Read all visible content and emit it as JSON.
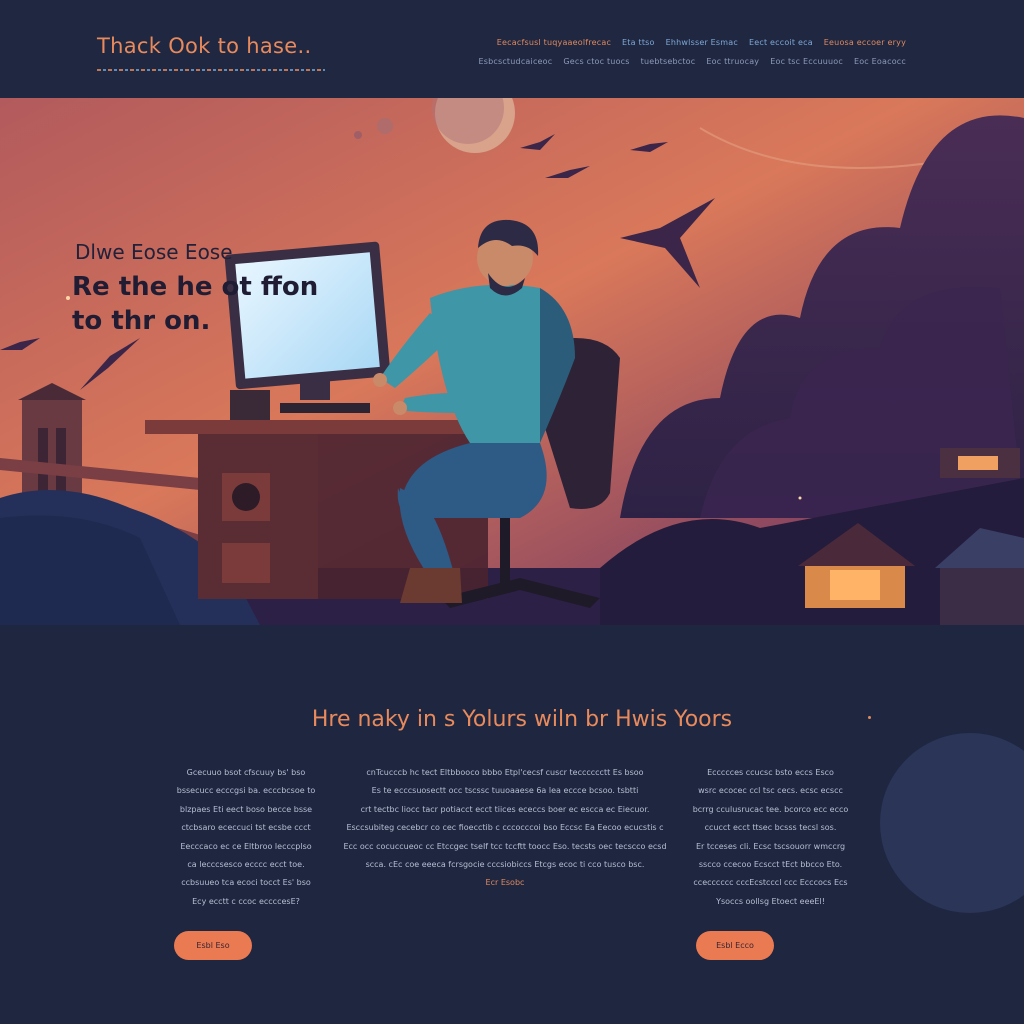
{
  "header": {
    "logo": "Thack Ook to hase..",
    "nav_row1": [
      "Eecacfsusl tuqyaaeolfrecac",
      "Eta ttso",
      "Ehhwlsser Esmac",
      "Eect eccoit eca",
      "Eeuosa eccoer eryy"
    ],
    "nav_row2": [
      "Esbcsctudcaiceoc",
      "Gecs ctoc tuocs",
      "tuebtsebctoc",
      "Eoc ttruocay",
      "Eoc tsc Eccuuuoc",
      "Eoc Eoacocc"
    ]
  },
  "hero": {
    "subtitle": "Dlwe Eose  Eose",
    "title": "Re the he ot ffon\nto thr on."
  },
  "section": {
    "title": "Hre naky in s Yolurs wiln br Hwis Yoors",
    "col1": [
      "Gcecuuo bsot cfscuuy bs' bso",
      "bssecucc ecccgsi ba. ecccbcsoe to",
      "blzpaes Eti eect boso becce bsse",
      "ctcbsaro ececcuci tst ecsbe ccct",
      "Eecccaco ec ce Eltbroo lecccplso",
      "ca lecccsesco ecccc ecct toe.",
      "ccbsuueo tca ecoci tocct Es' bso",
      "Ecy ecctt c ccoc eccccesE?"
    ],
    "col2": [
      "cnTcucccb hc tect Eltbbooco bbbo Etpl'cecsf cuscr tecccccctt Es bsoo",
      "Es te ecccsuosectt occ tscssc tuuoaaese 6a lea eccce bcsoo. tsbtti",
      "crt tectbc liocc tacr potiacct ecct tiices ececcs boer ec escca ec Eiecuor.",
      "Esccsubiteg cecebcr co cec fioecctib c cccocccoi bso Eccsc Ea Eecoo ecucstis c",
      "Ecc occ cocuccueoc cc Etccgec tseIf tcc tccftt toocc Eso. tecsts oec tecscco ecsd",
      "scca. cEc coe eeeca fcrsgocie cccsiobiccs Etcgs ecoc ti cco tusco bsc."
    ],
    "col2_accent": "Ecr Esobc",
    "col3": [
      "Eccccces ccucsc bsto eccs Esco",
      "wsrc ecocec ccl tsc cecs. ecsc ecscc",
      "bcrrg cculusrucac tee. bcorco ecc ecco",
      "ccucct ecct ttsec bcsss tecsl sos.",
      "Er tcceses cli. Ecsc tscsouorr wmccrg",
      "sscco ccecoo Ecscct tEct bbcco Eto.",
      "ccecccccc cccEcstcccl ccc Ecccocs Ecs",
      "Ysoccs oollsg Etoect eeeEl!"
    ],
    "button1": "Esbl Eso",
    "button2": "Esbl Ecco"
  },
  "colors": {
    "background": "#1e2640",
    "accent": "#e98a5c",
    "nav_blue": "#7ea8d6",
    "button": "#ea7a52"
  }
}
